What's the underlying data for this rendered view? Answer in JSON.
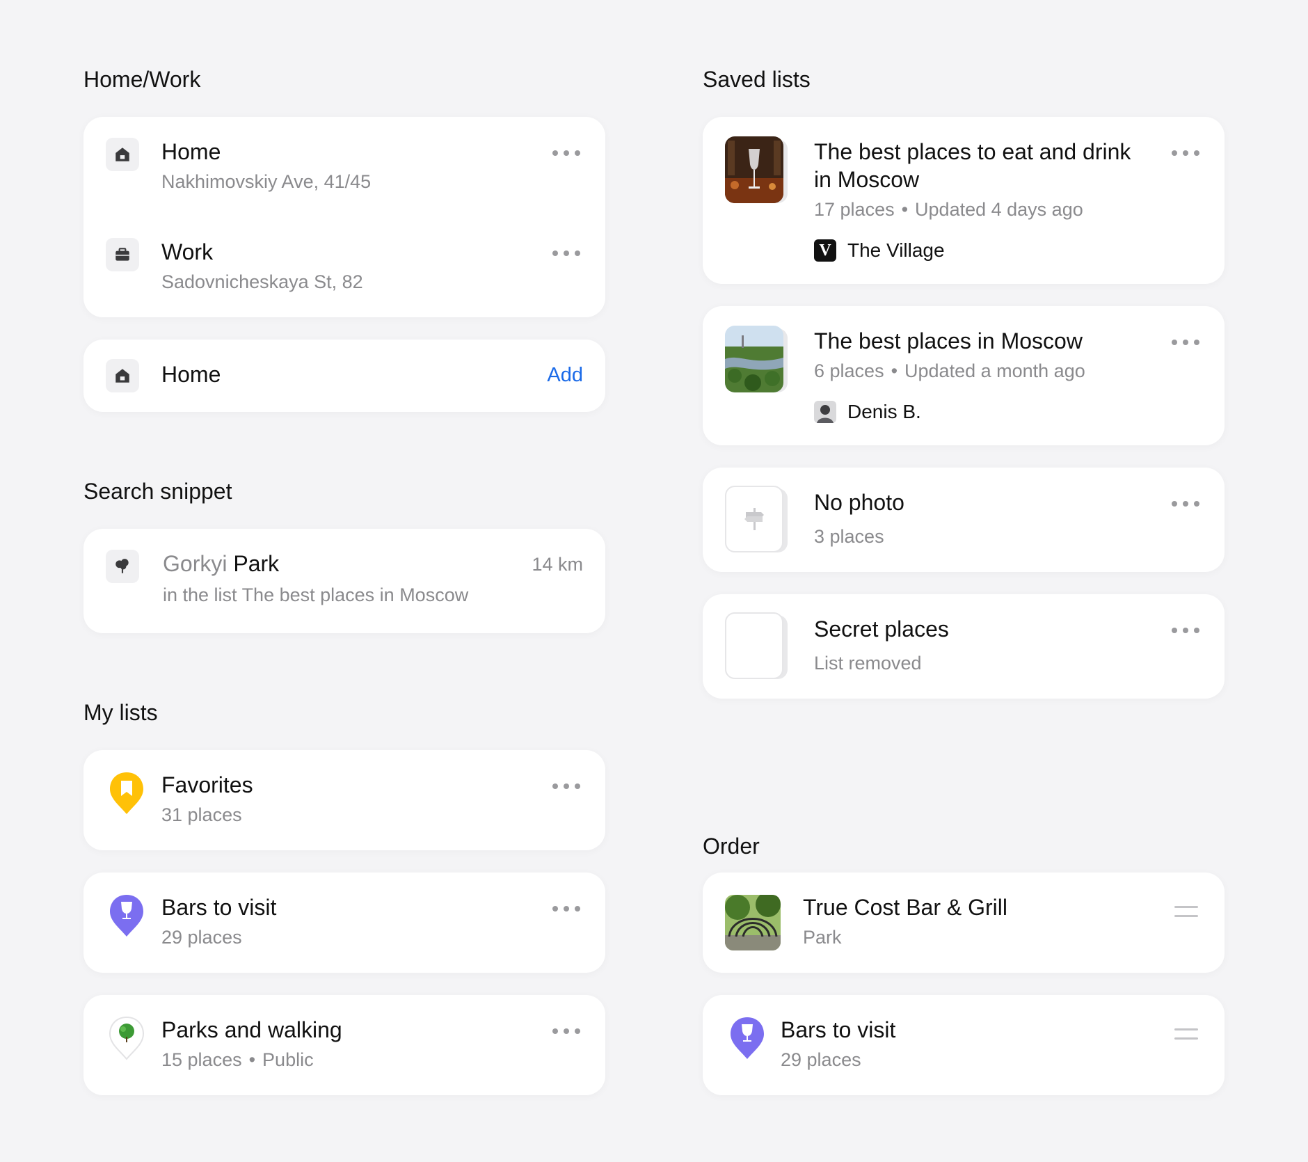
{
  "home_work": {
    "section_title": "Home/Work",
    "items": [
      {
        "title": "Home",
        "address": "Nakhimovskiy Ave, 41/45",
        "icon": "house-icon"
      },
      {
        "title": "Work",
        "address": "Sadovnicheskaya St, 82",
        "icon": "briefcase-icon"
      }
    ],
    "add_item": {
      "title": "Home",
      "action_label": "Add",
      "icon": "house-icon"
    }
  },
  "search_snippet": {
    "section_title": "Search snippet",
    "name_prefix": "Gorkyi",
    "name_match": "Park",
    "distance": "14 km",
    "subtitle": "in the list The best places in Moscow",
    "icon": "tree-icon"
  },
  "my_lists": {
    "section_title": "My lists",
    "items": [
      {
        "title": "Favorites",
        "count": "31 places",
        "icon": "bookmark-pin-icon",
        "color": "#ffc107"
      },
      {
        "title": "Bars to visit",
        "count": "29 places",
        "icon": "wine-glass-pin-icon",
        "color": "#7b6ef0"
      },
      {
        "title": "Parks and walking",
        "count": "15 places",
        "visibility": "Public",
        "icon": "tree-pin-icon",
        "color": "#3c9a35"
      }
    ]
  },
  "saved_lists": {
    "section_title": "Saved lists",
    "items": [
      {
        "title_line1": "The best places to eat and drink",
        "title_line2": "in Moscow",
        "count": "17 places",
        "updated": "Updated 4 days ago",
        "author": "The Village",
        "author_icon": "v-logo-icon"
      },
      {
        "title": "The best places in Moscow",
        "count": "6 places",
        "updated": "Updated a month ago",
        "author": "Denis B.",
        "author_icon": "avatar-icon"
      },
      {
        "title": "No photo",
        "count": "3 places",
        "icon": "signpost-icon"
      },
      {
        "title": "Secret places",
        "status": "List removed"
      }
    ]
  },
  "order": {
    "section_title": "Order",
    "items": [
      {
        "title": "True Cost Bar & Grill",
        "subtitle": "Park"
      },
      {
        "title": "Bars to visit",
        "subtitle": "29 places",
        "icon": "wine-glass-pin-icon",
        "color": "#7b6ef0"
      }
    ]
  },
  "colors": {
    "background": "#f4f4f6",
    "card": "#ffffff",
    "link": "#1a6ae8",
    "secondary_text": "#8a8a8d"
  }
}
